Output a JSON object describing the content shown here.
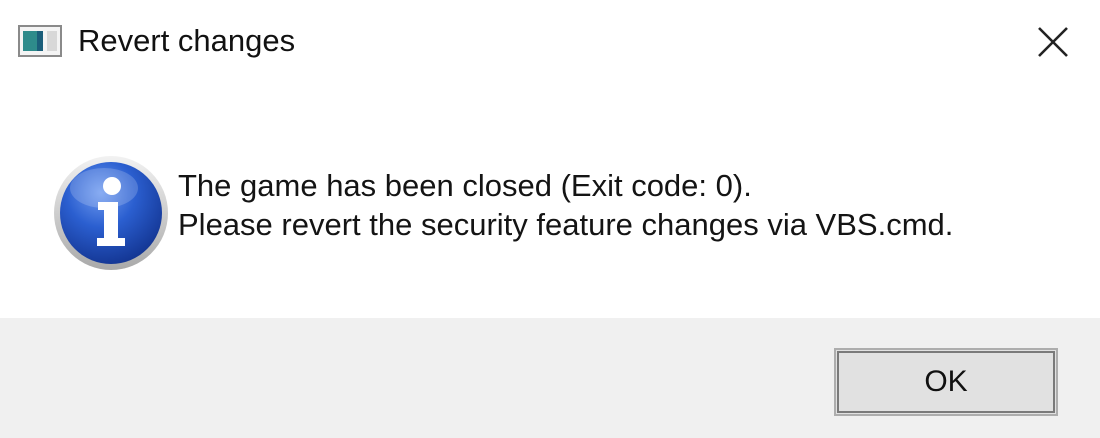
{
  "window": {
    "title": "Revert changes",
    "app_icon": "application-window-icon",
    "close_icon": "close-icon"
  },
  "message": {
    "icon": "information-icon",
    "line1": "The game has been closed (Exit code: 0).",
    "line2": "Please revert the security feature changes via VBS.cmd."
  },
  "buttons": {
    "ok_label": "OK"
  },
  "colors": {
    "footer_background": "#f0f0f0",
    "dialog_background": "#ffffff",
    "info_icon_blue": "#1f4fb8"
  }
}
